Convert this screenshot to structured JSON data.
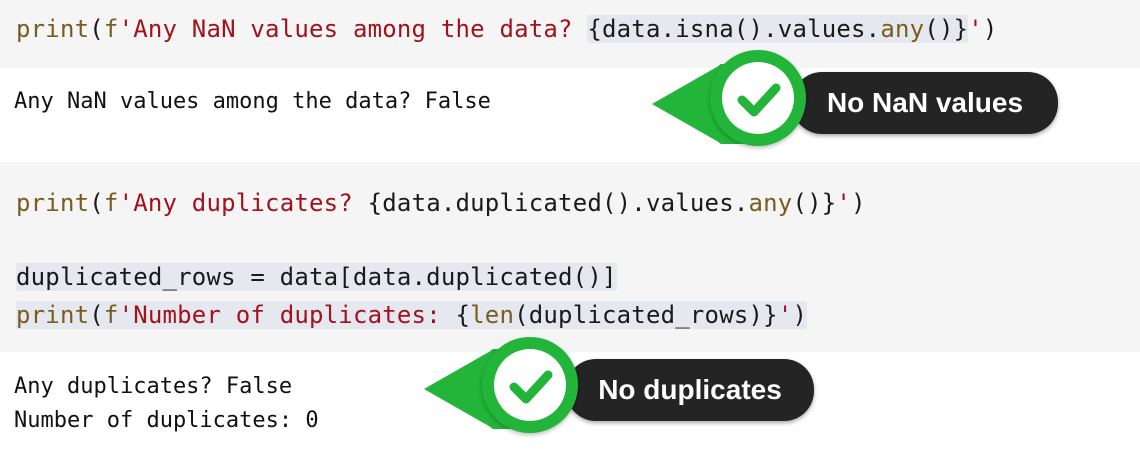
{
  "cells": [
    {
      "code_line_1": {
        "fn": "print",
        "open": "(",
        "fprefix": "f",
        "str_start": "'Any NaN values among the data? ",
        "expr_open": "{",
        "expr": "data.isna().values.",
        "method": "any",
        "call": "()",
        "expr_close": "}",
        "str_end": "'",
        "close": ")"
      },
      "output": [
        "Any NaN values among the data? False"
      ],
      "badge": "No NaN values"
    },
    {
      "code_line_1": {
        "fn": "print",
        "open": "(",
        "fprefix": "f",
        "str_start": "'Any duplicates? ",
        "expr_open": "{",
        "expr": "data.duplicated().values.",
        "method": "any",
        "call": "()",
        "expr_close": "}",
        "str_end": "'",
        "close": ")"
      },
      "code_line_2": "duplicated_rows = data[data.duplicated()]",
      "code_line_3": {
        "fn": "print",
        "open": "(",
        "fprefix": "f",
        "str_start": "'Number of duplicates: ",
        "expr_open": "{",
        "fn2": "len",
        "expr": "(duplicated_rows)",
        "expr_close": "}",
        "str_end": "'",
        "close": ")"
      },
      "output": [
        "Any duplicates? False",
        "Number of duplicates: 0"
      ],
      "badge": "No duplicates"
    }
  ],
  "colors": {
    "green": "#22b53a",
    "pill": "#242424",
    "keyword": "#7a5c1e",
    "string": "#a2121c"
  },
  "icons": [
    "check-icon"
  ]
}
